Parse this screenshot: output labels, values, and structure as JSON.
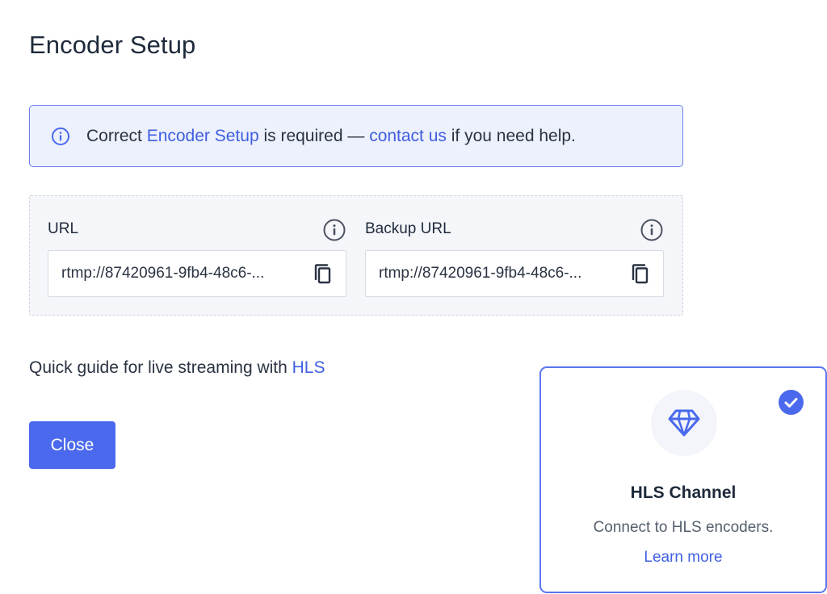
{
  "header": {
    "title": "Encoder Setup"
  },
  "alert": {
    "icon": "info-icon",
    "text_before": "Correct ",
    "link1": "Encoder Setup",
    "text_middle": " is required — ",
    "link2": "contact us",
    "text_after": " if you need help."
  },
  "urls": {
    "primary": {
      "label": "URL",
      "value": "rtmp://87420961-9fb4-48c6-...",
      "help_icon": "info-circle-icon",
      "copy_icon": "copy-icon"
    },
    "backup": {
      "label": "Backup URL",
      "value": "rtmp://87420961-9fb4-48c6-...",
      "help_icon": "info-circle-icon",
      "copy_icon": "copy-icon"
    }
  },
  "guide": {
    "text": "Quick guide for live streaming with ",
    "link": "HLS"
  },
  "actions": {
    "close_label": "Close"
  },
  "channel_card": {
    "icon": "diamond-icon",
    "selected": true,
    "title": "HLS Channel",
    "description": "Connect to HLS encoders.",
    "link": "Learn more"
  },
  "colors": {
    "accent": "#4a69ec",
    "link": "#3f5fe0",
    "alert_bg": "#edf0fd",
    "panel_bg": "#f5f6fa",
    "text": "#1e2a3b"
  }
}
